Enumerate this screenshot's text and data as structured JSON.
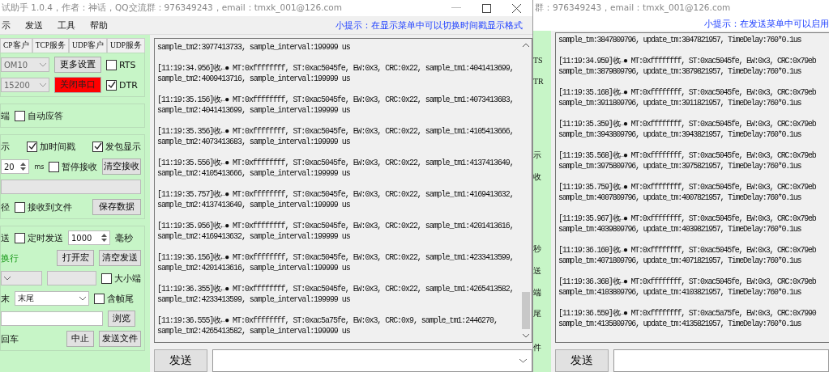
{
  "front_window": {
    "title": "试助手 1.0.4，作者：神话，QQ交流群：976349243，email：tmxk_001@126.com",
    "menu": [
      "示",
      "发送",
      "工具",
      "帮助"
    ],
    "tip": "小提示：在显示菜单中可以切换时间戳显示格式",
    "tabs": [
      {
        "label": "CP客户",
        "selected": false
      },
      {
        "label": "TCP服务",
        "selected": false
      },
      {
        "label": "UDP客户",
        "selected": false
      },
      {
        "label": "UDP服务",
        "selected": false
      }
    ],
    "port": "OM10",
    "baud": "15200",
    "more_settings_button": "更多设置",
    "close_port_button": "关闭串口",
    "rts": {
      "label": "RTS",
      "checked": false
    },
    "dtr": {
      "label": "DTR",
      "checked": true
    },
    "terminal_label": "端",
    "auto_reply": {
      "label": "自动应答",
      "checked": false
    },
    "receive": {
      "label": "示",
      "timestamp": {
        "label": "加时间戳",
        "checked": true
      },
      "show_packets": {
        "label": "发包显示",
        "checked": true
      },
      "interval": "20",
      "interval_unit": "ms",
      "pause": {
        "label": "暂停接收",
        "checked": false
      },
      "clear_button": "清空接收",
      "path_label": "径",
      "to_file": {
        "label": "接收到文件",
        "checked": false
      },
      "save_button": "保存数据"
    },
    "send": {
      "label": "送",
      "timed": {
        "label": "定时发送",
        "checked": false
      },
      "period": "1000",
      "period_unit": "毫秒",
      "newline_hint": "换行",
      "macro_button": "打开宏",
      "clear_button": "清空发送",
      "endian": {
        "label": "大小端",
        "checked": false
      },
      "end_label": "末",
      "end_value": "末尾",
      "frame_tail": {
        "label": "含帧尾",
        "checked": false
      },
      "browse_button": "浏览",
      "cr_label": "回车",
      "stop_button": "中止",
      "send_file_button": "发送文件"
    },
    "log": [
      {
        "lines": [
          "sample_tm2:3977413733, sample_interval:199999 us"
        ]
      },
      {
        "lines": [
          "[11:19:34.956]收←● MT:0xffffffff, ST:0xac5045fe, EW:0x3, CRC:0x22, sample_tm1:4041413699,",
          "sample_tm2:4009413716, sample_interval:199999 us"
        ]
      },
      {
        "lines": [
          "[11:19:35.156]收←● MT:0xffffffff, ST:0xac5045fe, EW:0x3, CRC:0x22, sample_tm1:4073413683,",
          "sample_tm2:4041413699, sample_interval:199999 us"
        ]
      },
      {
        "lines": [
          "[11:19:35.356]收←● MT:0xffffffff, ST:0xac5045fe, EW:0x3, CRC:0x22, sample_tm1:4105413666,",
          "sample_tm2:4073413683, sample_interval:199999 us"
        ]
      },
      {
        "lines": [
          "[11:19:35.556]收←● MT:0xffffffff, ST:0xac5045fe, EW:0x3, CRC:0x22, sample_tm1:4137413649,",
          "sample_tm2:4105413666, sample_interval:199999 us"
        ]
      },
      {
        "lines": [
          "[11:19:35.757]收←● MT:0xffffffff, ST:0xac5045fe, EW:0x3, CRC:0x22, sample_tm1:4169413632,",
          "sample_tm2:4137413649, sample_interval:199999 us"
        ]
      },
      {
        "lines": [
          "[11:19:35.956]收←● MT:0xffffffff, ST:0xac5045fe, EW:0x3, CRC:0x22, sample_tm1:4201413616,",
          "sample_tm2:4169413632, sample_interval:199999 us"
        ]
      },
      {
        "lines": [
          "[11:19:36.156]收←● MT:0xffffffff, ST:0xac5045fe, EW:0x3, CRC:0x22, sample_tm1:4233413599,",
          "sample_tm2:4201413616, sample_interval:199999 us"
        ]
      },
      {
        "lines": [
          "[11:19:36.355]收←● MT:0xffffffff, ST:0xac5045fe, EW:0x3, CRC:0x22, sample_tm1:4265413582,",
          "sample_tm2:4233413599, sample_interval:199999 us"
        ]
      },
      {
        "lines": [
          "[11:19:36.555]收←● MT:0xffffffff, ST:0xac5a75fe, EW:0x3, CRC:0x9, sample_tm1:2446270,",
          "sample_tm2:4265413582, sample_interval:199999 us"
        ]
      }
    ],
    "send_button": "发送"
  },
  "back_window": {
    "title": "群：976349243，email：tmxk_001@126.com",
    "tip": "小提示：在发送菜单中可以启用",
    "side_fragments": [
      "TS",
      "TR",
      "示",
      "收",
      "秒",
      "送",
      "端",
      "尾",
      "件"
    ],
    "log": [
      {
        "lines": [
          "sample_tm:3847809796, update_tm:3847821957, TimeDelay:760*0.1us"
        ]
      },
      {
        "lines": [
          "[11:19:34.959]收←● MT:0xffffffff, ST:0xac5045fe, EW:0x3, CRC:0x79eb",
          "sample_tm:3879809796, update_tm:3879821957, TimeDelay:760*0.1us"
        ]
      },
      {
        "lines": [
          "[11:19:35.168]收←● MT:0xffffffff, ST:0xac5045fe, EW:0x3, CRC:0x79eb",
          "sample_tm:3911809796, update_tm:3911821957, TimeDelay:760*0.1us"
        ]
      },
      {
        "lines": [
          "[11:19:35.359]收←● MT:0xffffffff, ST:0xac5045fe, EW:0x3, CRC:0x79eb",
          "sample_tm:3943809796, update_tm:3943821957, TimeDelay:760*0.1us"
        ]
      },
      {
        "lines": [
          "[11:19:35.568]收←● MT:0xffffffff, ST:0xac5045fe, EW:0x3, CRC:0x79eb",
          "sample_tm:3975809796, update_tm:3975821957, TimeDelay:760*0.1us"
        ]
      },
      {
        "lines": [
          "[11:19:35.759]收←● MT:0xffffffff, ST:0xac5045fe, EW:0x3, CRC:0x79eb",
          "sample_tm:4007809796, update_tm:4007821957, TimeDelay:760*0.1us"
        ]
      },
      {
        "lines": [
          "[11:19:35.967]收←● MT:0xffffffff, ST:0xac5045fe, EW:0x3, CRC:0x79eb",
          "sample_tm:4039809796, update_tm:4039821957, TimeDelay:760*0.1us"
        ]
      },
      {
        "lines": [
          "[11:19:36.160]收←● MT:0xffffffff, ST:0xac5045fe, EW:0x3, CRC:0x79eb",
          "sample_tm:4071809796, update_tm:4071821957, TimeDelay:760*0.1us"
        ]
      },
      {
        "lines": [
          "[11:19:36.368]收←● MT:0xffffffff, ST:0xac5045fe, EW:0x3, CRC:0x79eb",
          "sample_tm:4103809796, update_tm:4103821957, TimeDelay:760*0.1us"
        ]
      },
      {
        "lines": [
          "[11:19:36.559]收←● MT:0xffffffff, ST:0xac5a75fe, EW:0x3, CRC:0x7990",
          "sample_tm:4135809796, update_tm:4135821957, TimeDelay:760*0.1us"
        ]
      }
    ],
    "send_button": "发送"
  }
}
